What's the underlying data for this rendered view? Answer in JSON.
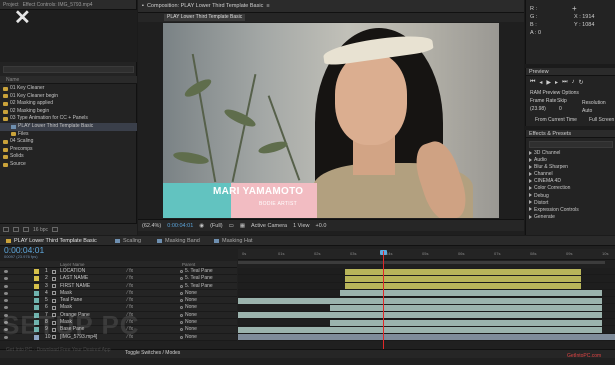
{
  "project_panel": {
    "tab_label": "Project",
    "effect_controls_label": "Effect Controls: IMG_5793.mp4",
    "items": [
      {
        "label": "01 Key Cleaner",
        "kind": "folder",
        "indent": false
      },
      {
        "label": "01 Key Cleaner begin",
        "kind": "folder",
        "indent": false
      },
      {
        "label": "02 Masking applied",
        "kind": "folder",
        "indent": false
      },
      {
        "label": "02 Masking begin",
        "kind": "folder",
        "indent": false
      },
      {
        "label": "03 Type Animation for CC + Panels",
        "kind": "folder",
        "indent": false
      },
      {
        "label": "PLAY Lower Third Template Basic",
        "kind": "comp",
        "indent": true
      },
      {
        "label": "Files",
        "kind": "folder",
        "indent": true
      },
      {
        "label": "04 Scaling",
        "kind": "folder",
        "indent": false
      },
      {
        "label": "Precomps",
        "kind": "folder",
        "indent": false
      },
      {
        "label": "Solids",
        "kind": "folder",
        "indent": false
      },
      {
        "label": "Source",
        "kind": "folder",
        "indent": false
      }
    ],
    "column_name": "Name",
    "bit_depth": "16 bpc"
  },
  "composition": {
    "tab_label": "Composition: PLAY Lower Third Template Basic",
    "subtab": "PLAY Lower Third Template Basic",
    "lower_third": {
      "name": "MARI YAMAMOTO",
      "subtitle": "BODIE ARTIST",
      "teal": "#62c3c0",
      "pink": "#f2bcc2"
    },
    "viewer_bar": {
      "zoom": "(62.4%)",
      "timecode": "0:00:04:01",
      "resolution": "(Full)",
      "camera": "Active Camera",
      "views": "1 View",
      "offset": "+0.0"
    }
  },
  "info_panel": {
    "r": "R :",
    "g": "G :",
    "b": "B :",
    "a": "A : 0",
    "x": "X : 1914",
    "y": "Y : 1084"
  },
  "preview_panel": {
    "title": "Preview",
    "ram_options": "RAM Preview Options",
    "frame_rate_label": "Frame Rate",
    "skip_label": "Skip",
    "resolution_label": "Resolution",
    "frame_rate_value": "(23.98)",
    "skip_value": "0",
    "resolution_value": "Auto",
    "from_current": "From Current Time",
    "full_screen": "Full Screen"
  },
  "effects_panel": {
    "title": "Effects & Presets",
    "items": [
      "3D Channel",
      "Audio",
      "Blur & Sharpen",
      "Channel",
      "CINEMA 4D",
      "Color Correction",
      "Debug",
      "Distort",
      "Expression Controls",
      "Generate"
    ]
  },
  "timeline": {
    "tabs": [
      {
        "label": "PLAY Lower Third Template Basic",
        "color": "#c9a23a"
      },
      {
        "label": "Scaling",
        "color": "#6e8fb0"
      },
      {
        "label": "Masking Band",
        "color": "#6e8fb0"
      },
      {
        "label": "Masking Hat",
        "color": "#6e8fb0"
      }
    ],
    "timecode": "0:00:04:01",
    "fps": "00097 (23.976 fps)",
    "columns": {
      "layer_name": "Layer Name",
      "parent": "Parent"
    },
    "ruler_ticks": [
      "0s",
      "01s",
      "02s",
      "03s",
      "04s",
      "05s",
      "06s",
      "07s",
      "08s",
      "09s",
      "10s"
    ],
    "layers": [
      {
        "num": "1",
        "name": "LOCATION",
        "parent": "5. Teal Pane",
        "label_color": "#d6c04a",
        "bar": {
          "start": 0.285,
          "end": 0.91,
          "color": "#b8b55a"
        }
      },
      {
        "num": "2",
        "name": "LAST NAME",
        "parent": "5. Teal Pane",
        "label_color": "#d6c04a",
        "bar": {
          "start": 0.285,
          "end": 0.91,
          "color": "#b8b55a"
        }
      },
      {
        "num": "3",
        "name": "FIRST NAME",
        "parent": "5. Teal Pane",
        "label_color": "#d6c04a",
        "bar": {
          "start": 0.285,
          "end": 0.91,
          "color": "#b8b55a"
        }
      },
      {
        "num": "4",
        "name": "Mask",
        "parent": "None",
        "label_color": "#6fb3ae",
        "bar": {
          "start": 0.27,
          "end": 0.965,
          "color": "#9bb3ad"
        }
      },
      {
        "num": "5",
        "name": "Teal Pane",
        "parent": "None",
        "label_color": "#6fb3ae",
        "bar": {
          "start": 0.0,
          "end": 0.965,
          "color": "#9bb3ad"
        }
      },
      {
        "num": "6",
        "name": "Mask",
        "parent": "None",
        "label_color": "#6fb3ae",
        "bar": {
          "start": 0.245,
          "end": 0.965,
          "color": "#9bb3ad"
        }
      },
      {
        "num": "7",
        "name": "Orange Pane",
        "parent": "None",
        "label_color": "#6fb3ae",
        "bar": {
          "start": 0.0,
          "end": 0.965,
          "color": "#9bb3ad"
        }
      },
      {
        "num": "8",
        "name": "Mask",
        "parent": "None",
        "label_color": "#6fb3ae",
        "bar": {
          "start": 0.245,
          "end": 0.965,
          "color": "#9bb3ad"
        }
      },
      {
        "num": "9",
        "name": "Base Pane",
        "parent": "None",
        "label_color": "#6fb3ae",
        "bar": {
          "start": 0.0,
          "end": 0.965,
          "color": "#9bb3ad"
        }
      },
      {
        "num": "10",
        "name": "[IMG_5793.mp4]",
        "parent": "None",
        "label_color": "#8fa6c4",
        "bar": {
          "start": 0.0,
          "end": 1.0,
          "color": "#7f8c9a"
        }
      }
    ],
    "toggle_label": "Toggle Switches / Modes",
    "playhead_fraction": 0.385,
    "playhead_color": "#e02828"
  },
  "watermark": {
    "text": "SETUP PC",
    "sub": "Get Into PC · Download Free Your Desired App",
    "right": "GetIntoPC.com"
  }
}
